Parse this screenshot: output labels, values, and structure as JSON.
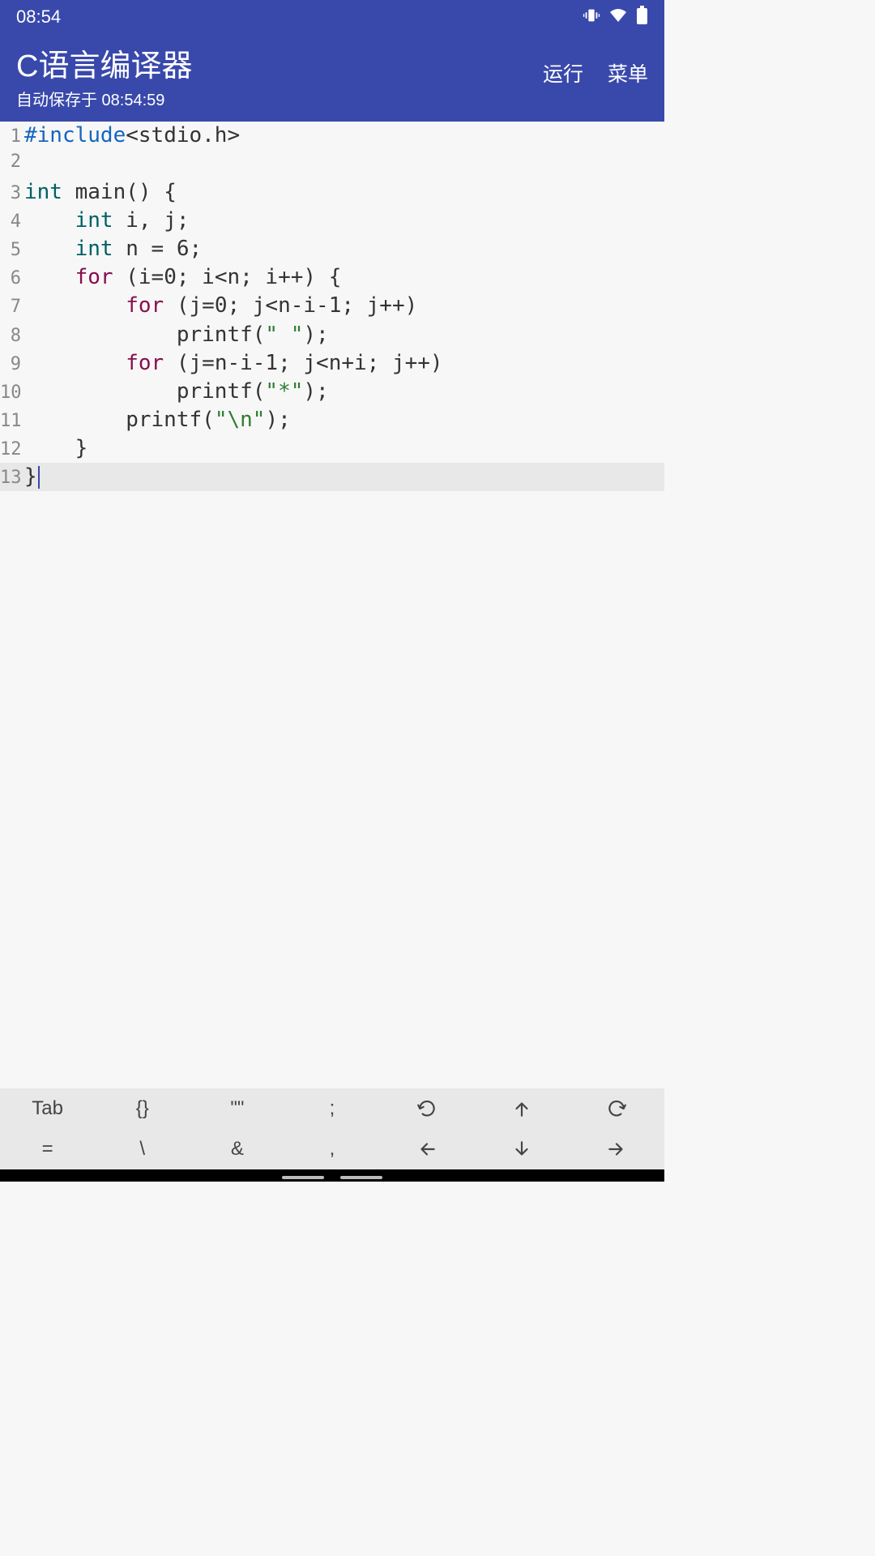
{
  "status": {
    "time": "08:54"
  },
  "app": {
    "title": "C语言编译器",
    "subtitle": "自动保存于 08:54:59",
    "run_label": "运行",
    "menu_label": "菜单"
  },
  "editor": {
    "cursor_line": 13,
    "lines": [
      {
        "n": 1,
        "tokens": [
          [
            "preproc",
            "#include"
          ],
          [
            "plain",
            "<stdio.h>"
          ]
        ]
      },
      {
        "n": 2,
        "tokens": [
          [
            "plain",
            ""
          ]
        ]
      },
      {
        "n": 3,
        "tokens": [
          [
            "keyword",
            "int"
          ],
          [
            "plain",
            " main() {"
          ]
        ]
      },
      {
        "n": 4,
        "tokens": [
          [
            "plain",
            "    "
          ],
          [
            "keyword",
            "int"
          ],
          [
            "plain",
            " i, j;"
          ]
        ]
      },
      {
        "n": 5,
        "tokens": [
          [
            "plain",
            "    "
          ],
          [
            "keyword",
            "int"
          ],
          [
            "plain",
            " n = 6;"
          ]
        ]
      },
      {
        "n": 6,
        "tokens": [
          [
            "plain",
            "    "
          ],
          [
            "control",
            "for"
          ],
          [
            "plain",
            " (i=0; i<n; i++) {"
          ]
        ]
      },
      {
        "n": 7,
        "tokens": [
          [
            "plain",
            "        "
          ],
          [
            "control",
            "for"
          ],
          [
            "plain",
            " (j=0; j<n-i-1; j++)"
          ]
        ]
      },
      {
        "n": 8,
        "tokens": [
          [
            "plain",
            "            printf("
          ],
          [
            "string",
            "\" \""
          ],
          [
            "plain",
            ");"
          ]
        ]
      },
      {
        "n": 9,
        "tokens": [
          [
            "plain",
            "        "
          ],
          [
            "control",
            "for"
          ],
          [
            "plain",
            " (j=n-i-1; j<n+i; j++)"
          ]
        ]
      },
      {
        "n": 10,
        "tokens": [
          [
            "plain",
            "            printf("
          ],
          [
            "string",
            "\"*\""
          ],
          [
            "plain",
            ");"
          ]
        ]
      },
      {
        "n": 11,
        "tokens": [
          [
            "plain",
            "        printf("
          ],
          [
            "string",
            "\"\\n\""
          ],
          [
            "plain",
            ");"
          ]
        ]
      },
      {
        "n": 12,
        "tokens": [
          [
            "plain",
            "    }"
          ]
        ]
      },
      {
        "n": 13,
        "tokens": [
          [
            "plain",
            "}"
          ]
        ]
      }
    ]
  },
  "bottombar": {
    "row1": [
      "Tab",
      "{}",
      "\"\"",
      ";",
      "undo-icon",
      "arrow-up-icon",
      "redo-icon"
    ],
    "row2": [
      "=",
      "\\",
      "&",
      ",",
      "arrow-left-icon",
      "arrow-down-icon",
      "arrow-right-icon"
    ]
  }
}
